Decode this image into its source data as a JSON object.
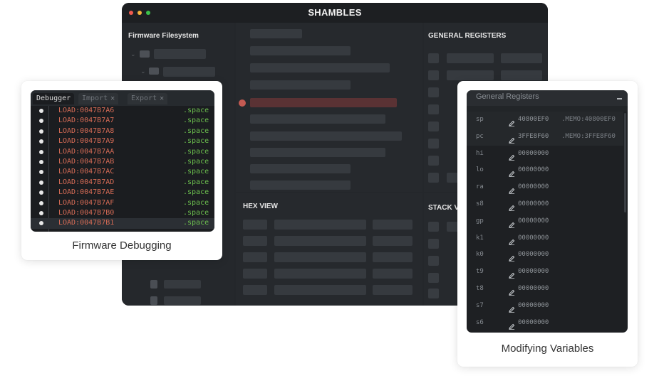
{
  "app": {
    "title": "SHAMBLES",
    "colors": {
      "close": "#f05a4e",
      "minimize": "#f4b43c",
      "zoom": "#3cc24a"
    }
  },
  "panes": {
    "filesystem_title": "Firmware Filesystem",
    "registers_title": "GENERAL REGISTERS",
    "hex_title": "HEX VIEW",
    "stack_title": "STACK V"
  },
  "debugger_card": {
    "caption": "Firmware Debugging",
    "tabs": [
      {
        "label": "Debugger",
        "active": true
      },
      {
        "label": "Import",
        "closable": true
      },
      {
        "label": "Export",
        "closable": true
      }
    ],
    "rows": [
      {
        "addr": "LOAD:0047B7A6",
        "kw": ".space"
      },
      {
        "addr": "LOAD:0047B7A7",
        "kw": ".space"
      },
      {
        "addr": "LOAD:0047B7A8",
        "kw": ".space"
      },
      {
        "addr": "LOAD:0047B7A9",
        "kw": ".space"
      },
      {
        "addr": "LOAD:0047B7AA",
        "kw": ".space"
      },
      {
        "addr": "LOAD:0047B7AB",
        "kw": ".space"
      },
      {
        "addr": "LOAD:0047B7AC",
        "kw": ".space"
      },
      {
        "addr": "LOAD:0047B7AD",
        "kw": ".space"
      },
      {
        "addr": "LOAD:0047B7AE",
        "kw": ".space"
      },
      {
        "addr": "LOAD:0047B7AF",
        "kw": ".space"
      },
      {
        "addr": "LOAD:0047B7B0",
        "kw": ".space"
      },
      {
        "addr": "LOAD:0047B7B1",
        "kw": ".space"
      }
    ],
    "colors": {
      "address": "#d66b55",
      "keyword": "#6cbf4e"
    }
  },
  "registers_card": {
    "caption": "Modifying Variables",
    "title": "General Registers",
    "rows": [
      {
        "name": "sp",
        "value": "40800EF0",
        "ref": ".MEMO:40800EF0"
      },
      {
        "name": "pc",
        "value": "3FFE8F60",
        "ref": ".MEMO:3FFE8F60"
      },
      {
        "name": "hi",
        "value": "00000000"
      },
      {
        "name": "lo",
        "value": "00000000"
      },
      {
        "name": "ra",
        "value": "00000000"
      },
      {
        "name": "s8",
        "value": "00000000"
      },
      {
        "name": "gp",
        "value": "00000000"
      },
      {
        "name": "k1",
        "value": "00000000"
      },
      {
        "name": "k0",
        "value": "00000000"
      },
      {
        "name": "t9",
        "value": "00000000"
      },
      {
        "name": "t8",
        "value": "00000000"
      },
      {
        "name": "s7",
        "value": "00000000"
      },
      {
        "name": "s6",
        "value": "00000000"
      }
    ]
  }
}
